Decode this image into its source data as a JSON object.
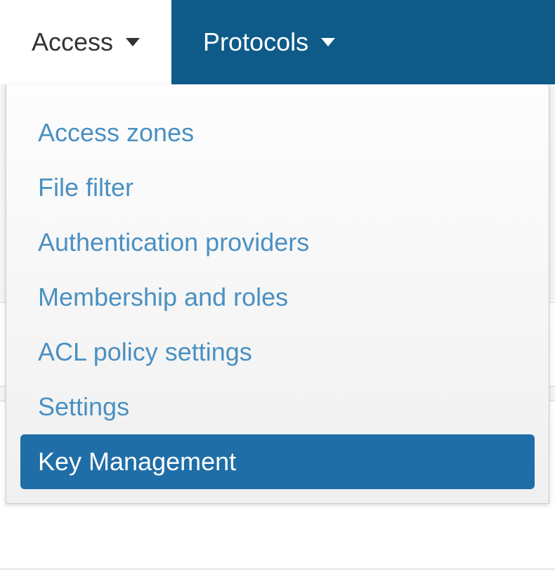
{
  "nav": {
    "tabs": [
      {
        "label": "Access",
        "active": true
      },
      {
        "label": "Protocols",
        "active": false
      }
    ]
  },
  "dropdown": {
    "items": [
      {
        "label": "Access zones",
        "selected": false
      },
      {
        "label": "File filter",
        "selected": false
      },
      {
        "label": "Authentication providers",
        "selected": false
      },
      {
        "label": "Membership and roles",
        "selected": false
      },
      {
        "label": "ACL policy settings",
        "selected": false
      },
      {
        "label": "Settings",
        "selected": false
      },
      {
        "label": "Key Management",
        "selected": true
      }
    ]
  }
}
